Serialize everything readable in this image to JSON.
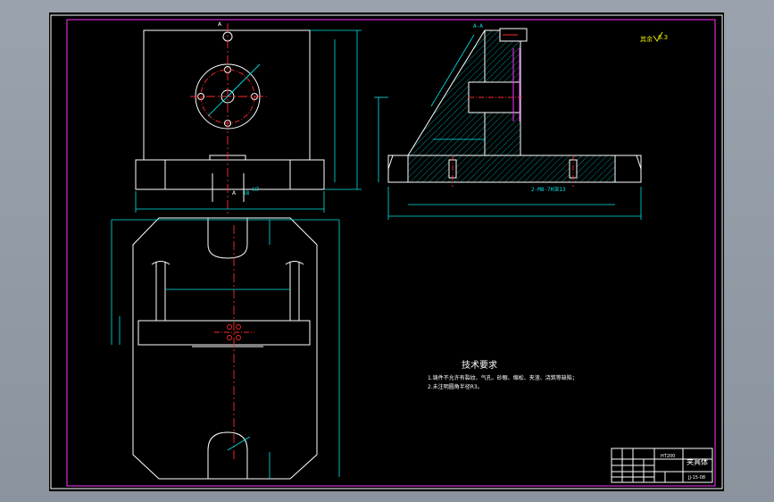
{
  "drawing": {
    "roughness_note": "其余",
    "roughness_value": "6.3",
    "section_label": "A-A",
    "section_mark": "A",
    "dim_bottom_thread": "2-M8-7H深13",
    "dim_slot": "18",
    "dim_slot_tol": "H7"
  },
  "notes": {
    "title": "技术要求",
    "line1": "1.铸件不允许有裂纹、气孔、砂眼、缩松、夹渣、浇筑等缺陷；",
    "line2": "2.未注明圆角半径R3。"
  },
  "title_block": {
    "part_name": "夹具体",
    "material": "HT200",
    "drawing_no": "JJ-15-08"
  }
}
